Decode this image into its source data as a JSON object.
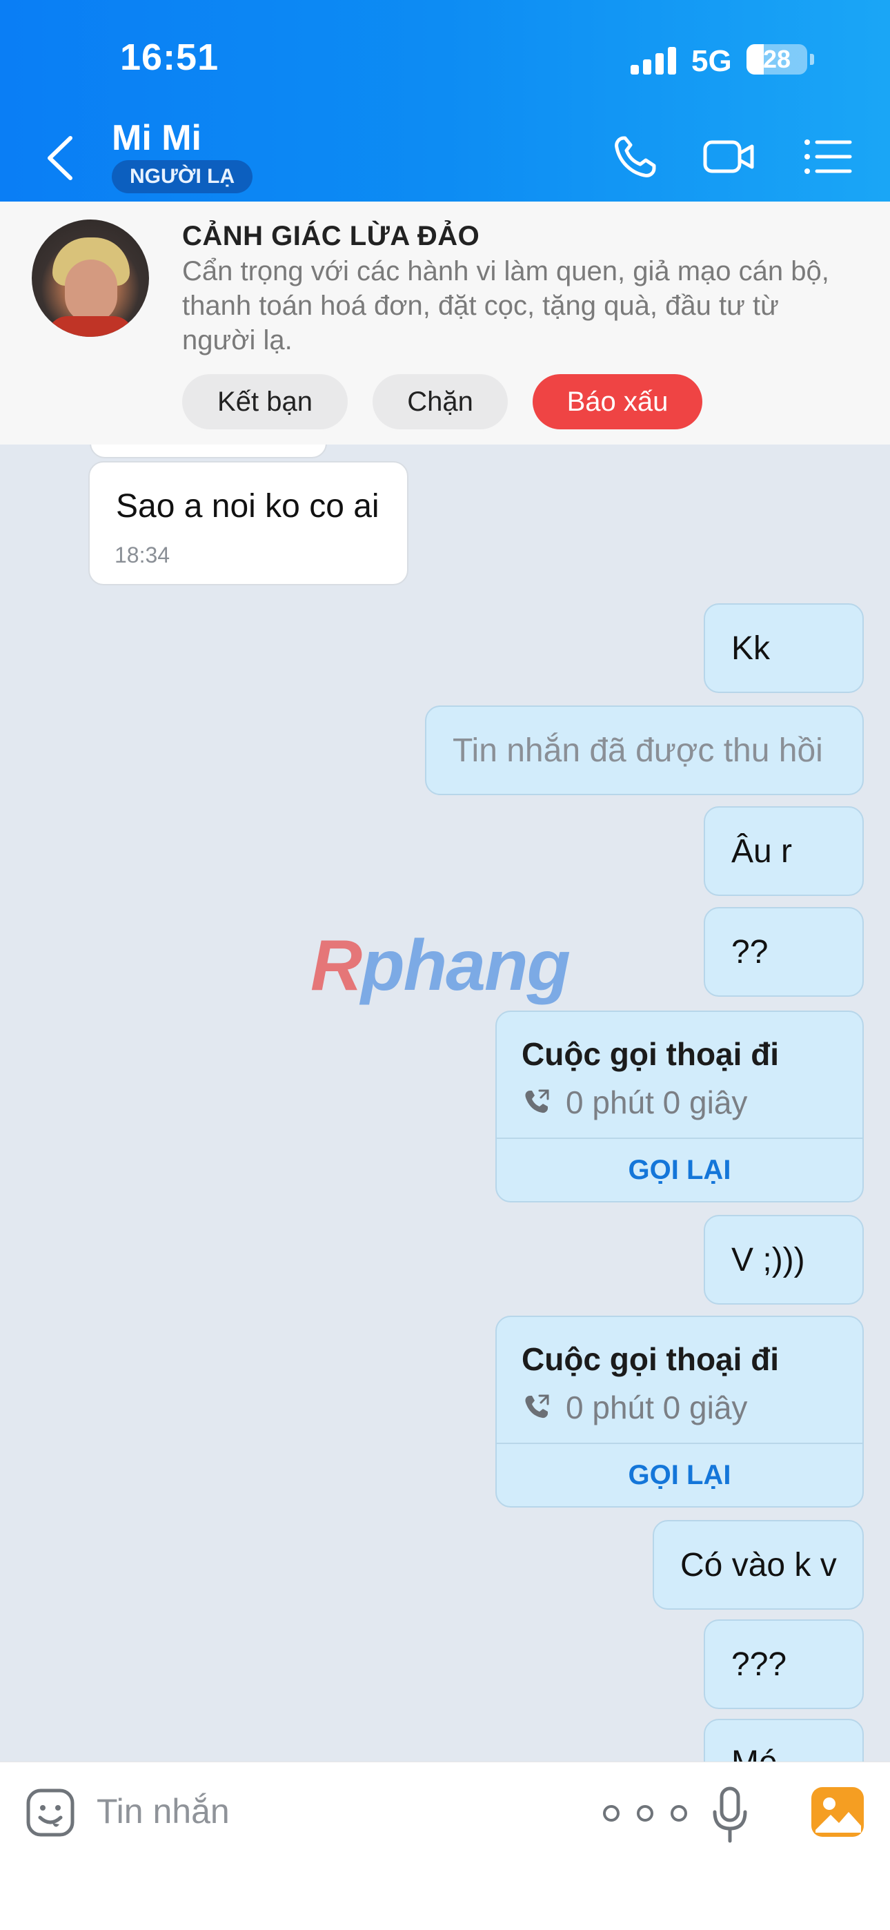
{
  "status_bar": {
    "time": "16:51",
    "network": "5G",
    "battery": "28",
    "battery_level_pct": 28
  },
  "header": {
    "contact_name": "Mi Mi",
    "badge": "NGƯỜI LẠ",
    "icons": [
      "back-icon",
      "phone-icon",
      "video-camera-icon",
      "menu-list-icon"
    ]
  },
  "warning": {
    "title": "CẢNH GIÁC LỪA ĐẢO",
    "text": "Cẩn trọng với các hành vi làm quen, giả mạo cán bộ, thanh toán hoá đơn, đặt cọc, tặng quà, đầu tư từ người lạ.",
    "buttons": {
      "add_friend": "Kết bạn",
      "block": "Chặn",
      "report": "Báo xấu"
    }
  },
  "messages": {
    "m1": {
      "text": "Sao a noi ko co ai",
      "time": "18:34"
    },
    "m2": {
      "text": "Kk"
    },
    "m3": {
      "text": "Tin nhắn đã được thu hồi"
    },
    "m4": {
      "text": "Âu r"
    },
    "m5": {
      "text": "??"
    },
    "call1": {
      "title": "Cuộc gọi thoại đi",
      "duration": "0 phút 0 giây",
      "action": "GỌI LẠI"
    },
    "m6": {
      "text": "V ;)))"
    },
    "call2": {
      "title": "Cuộc gọi thoại đi",
      "duration": "0 phút 0 giây",
      "action": "GỌI LẠI"
    },
    "m7": {
      "text": "Có vào k v"
    },
    "m8": {
      "text": "???"
    },
    "m9": {
      "text": "Mé"
    }
  },
  "watermark": {
    "first": "R",
    "rest": "phang"
  },
  "composer": {
    "placeholder": "Tin nhắn",
    "icons": [
      "emoji-sticker-icon",
      "more-dots-icon",
      "microphone-icon",
      "image-gallery-icon"
    ]
  },
  "colors": {
    "header_start": "#0a7ef5",
    "header_end": "#1aa6f6",
    "report_red": "#ef4444",
    "outgoing_bubble": "#d2ecfb",
    "chat_bg": "#e2e8f0",
    "link_blue": "#1476d9"
  }
}
